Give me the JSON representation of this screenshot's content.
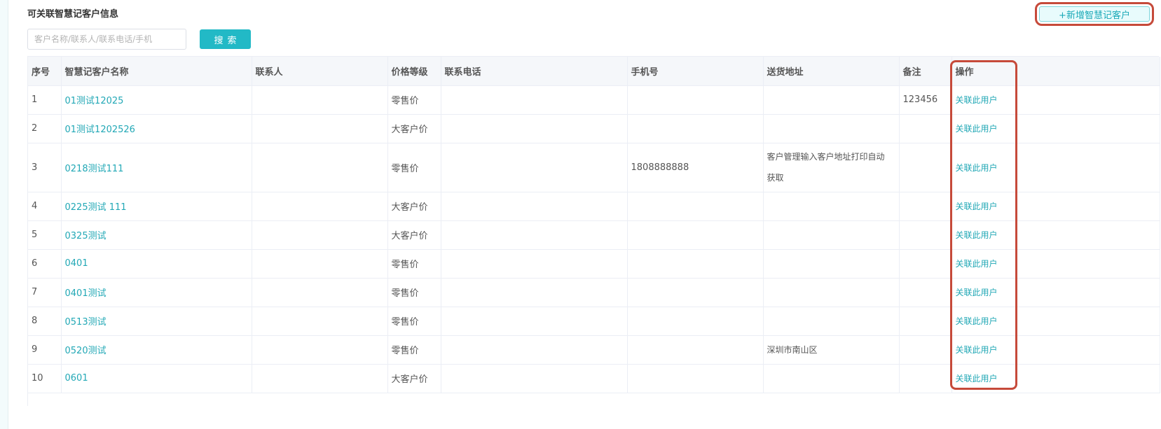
{
  "page": {
    "title": "可关联智慧记客户信息",
    "add_button_label": "+新增智慧记客户"
  },
  "search": {
    "placeholder": "客户名称/联系人/联系电话/手机",
    "value": "",
    "button_label": "搜索"
  },
  "table": {
    "headers": [
      "序号",
      "智慧记客户名称",
      "联系人",
      "价格等级",
      "联系电话",
      "手机号",
      "送货地址",
      "备注",
      "操作"
    ],
    "action_label": "关联此用户",
    "rows": [
      {
        "no": "1",
        "name": "01测试12025",
        "contact": "",
        "price_level": "零售价",
        "phone": "",
        "mobile": "",
        "address_line1": "",
        "address_line2": "",
        "remark": "123456"
      },
      {
        "no": "2",
        "name": "01测试1202526",
        "contact": "",
        "price_level": "大客户价",
        "phone": "",
        "mobile": "",
        "address_line1": "",
        "address_line2": "",
        "remark": ""
      },
      {
        "no": "3",
        "name": "0218测试111",
        "contact": "",
        "price_level": "零售价",
        "phone": "",
        "mobile": "1808888888",
        "address_line1": "客户管理输入客户地址打印自动",
        "address_line2": "获取",
        "remark": ""
      },
      {
        "no": "4",
        "name": "0225测试 111",
        "contact": "",
        "price_level": "大客户价",
        "phone": "",
        "mobile": "",
        "address_line1": "",
        "address_line2": "",
        "remark": ""
      },
      {
        "no": "5",
        "name": "0325测试",
        "contact": "",
        "price_level": "大客户价",
        "phone": "",
        "mobile": "",
        "address_line1": "",
        "address_line2": "",
        "remark": ""
      },
      {
        "no": "6",
        "name": "0401",
        "contact": "",
        "price_level": "零售价",
        "phone": "",
        "mobile": "",
        "address_line1": "",
        "address_line2": "",
        "remark": ""
      },
      {
        "no": "7",
        "name": "0401测试",
        "contact": "",
        "price_level": "零售价",
        "phone": "",
        "mobile": "",
        "address_line1": "",
        "address_line2": "",
        "remark": ""
      },
      {
        "no": "8",
        "name": "0513测试",
        "contact": "",
        "price_level": "零售价",
        "phone": "",
        "mobile": "",
        "address_line1": "",
        "address_line2": "",
        "remark": ""
      },
      {
        "no": "9",
        "name": "0520测试",
        "contact": "",
        "price_level": "零售价",
        "phone": "",
        "mobile": "",
        "address_line1": "深圳市南山区",
        "address_line2": "",
        "remark": ""
      },
      {
        "no": "10",
        "name": "0601",
        "contact": "",
        "price_level": "大客户价",
        "phone": "",
        "mobile": "",
        "address_line1": "",
        "address_line2": "",
        "remark": ""
      }
    ]
  },
  "colors": {
    "accent": "#22b9c6",
    "link": "#22a8b6",
    "highlight_outline": "#c64a3a"
  }
}
